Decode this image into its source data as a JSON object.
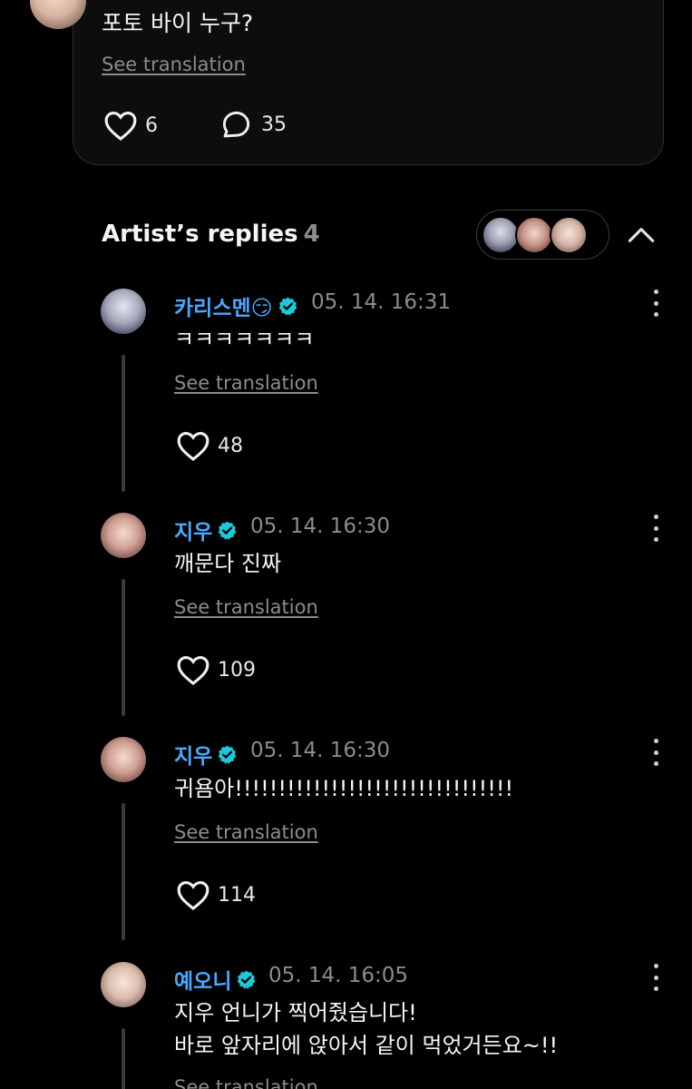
{
  "post": {
    "text": "포토 바이 누구?",
    "see_translation": "See translation",
    "likes": "6",
    "comments": "35"
  },
  "replies_header": {
    "title": "Artist’s replies",
    "count": "4"
  },
  "replies": [
    {
      "name": "카리스멘😏",
      "time": "05. 14. 16:31",
      "text": "ㅋㅋㅋㅋㅋㅋㅋ",
      "see_translation": "See translation",
      "likes": "48"
    },
    {
      "name": "지우",
      "time": "05. 14. 16:30",
      "text": "깨문다 진짜",
      "see_translation": "See translation",
      "likes": "109"
    },
    {
      "name": "지우",
      "time": "05. 14. 16:30",
      "text": "귀욤아!!!!!!!!!!!!!!!!!!!!!!!!!!!!!!!!",
      "see_translation": "See translation",
      "likes": "114"
    },
    {
      "name": "예오니",
      "time": "05. 14. 16:05",
      "text": "지우 언니가 찍어줬습니다!\n바로 앞자리에 앉아서 같이 먹었거든요~!!",
      "see_translation": "See translation"
    }
  ],
  "colors": {
    "background": "#000000",
    "artist_name": "#4aa8ff",
    "verified_badge": "#1ec8d8",
    "muted_text": "#8c8c8c"
  },
  "icons": [
    "heart-icon",
    "comment-icon",
    "chevron-up-icon",
    "verified-icon",
    "more-vertical-icon"
  ]
}
